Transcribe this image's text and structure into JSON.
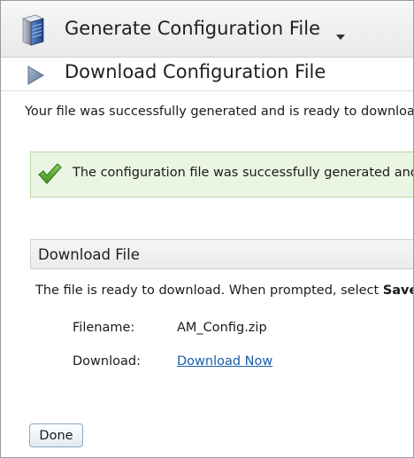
{
  "header": {
    "title": "Generate Configuration File",
    "icon": "server-icon",
    "menu_icon": "caret-down-icon"
  },
  "subheader": {
    "title": "Download Configuration File",
    "icon": "play-arrow-icon"
  },
  "intro_text": "Your file was successfully generated and is ready to download.",
  "success_message": {
    "text": "The configuration file was successfully generated and is ready.",
    "icon": "checkmark-icon",
    "background_color": "#eaf5e3",
    "border_color": "#b7d7a6"
  },
  "download_section": {
    "title": "Download File",
    "instructions_prefix": "The file is ready to download. When prompted, select ",
    "instructions_bold": "Save",
    "filename_label": "Filename:",
    "filename_value": "AM_Config.zip",
    "download_label": "Download:",
    "download_link": "Download Now",
    "link_color": "#1a5ea8"
  },
  "footer": {
    "done_label": "Done"
  }
}
